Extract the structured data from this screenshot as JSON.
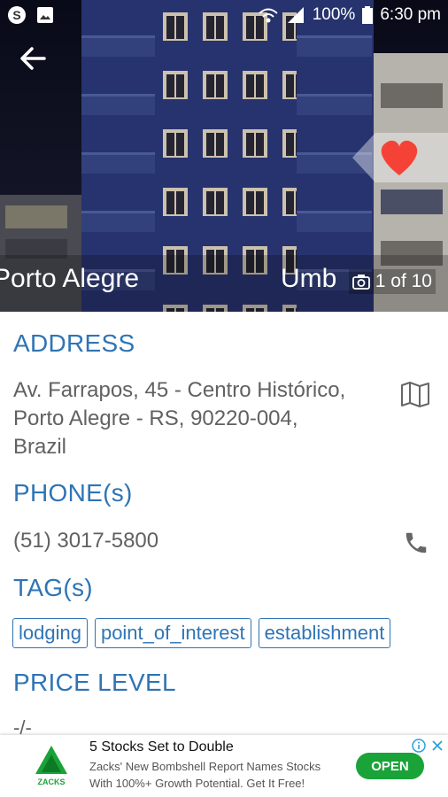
{
  "status_bar": {
    "battery": "100%",
    "time": "6:30 pm"
  },
  "photo": {
    "title_left": "Porto Alegre",
    "title_right": "Umb",
    "counter": "1 of 10"
  },
  "address": {
    "heading": "ADDRESS",
    "line1": "Av. Farrapos, 45 - Centro Histórico,",
    "line2": "Porto Alegre - RS, 90220-004,",
    "line3": "Brazil"
  },
  "phone": {
    "heading": "PHONE(s)",
    "number": "(51) 3017-5800"
  },
  "tags": {
    "heading": "TAG(s)",
    "items": [
      "lodging",
      "point_of_interest",
      "establishment"
    ]
  },
  "price": {
    "heading": "PRICE LEVEL",
    "value": "-/-"
  },
  "ad": {
    "logo_text": "ZACKS",
    "title": "5 Stocks Set to Double",
    "desc": "Zacks' New Bombshell Report Names Stocks With 100%+ Growth Potential. Get It Free!",
    "cta": "OPEN"
  },
  "colors": {
    "accent": "#2f74b5",
    "favorite": "#f44336",
    "ad_button": "#1aa338"
  }
}
